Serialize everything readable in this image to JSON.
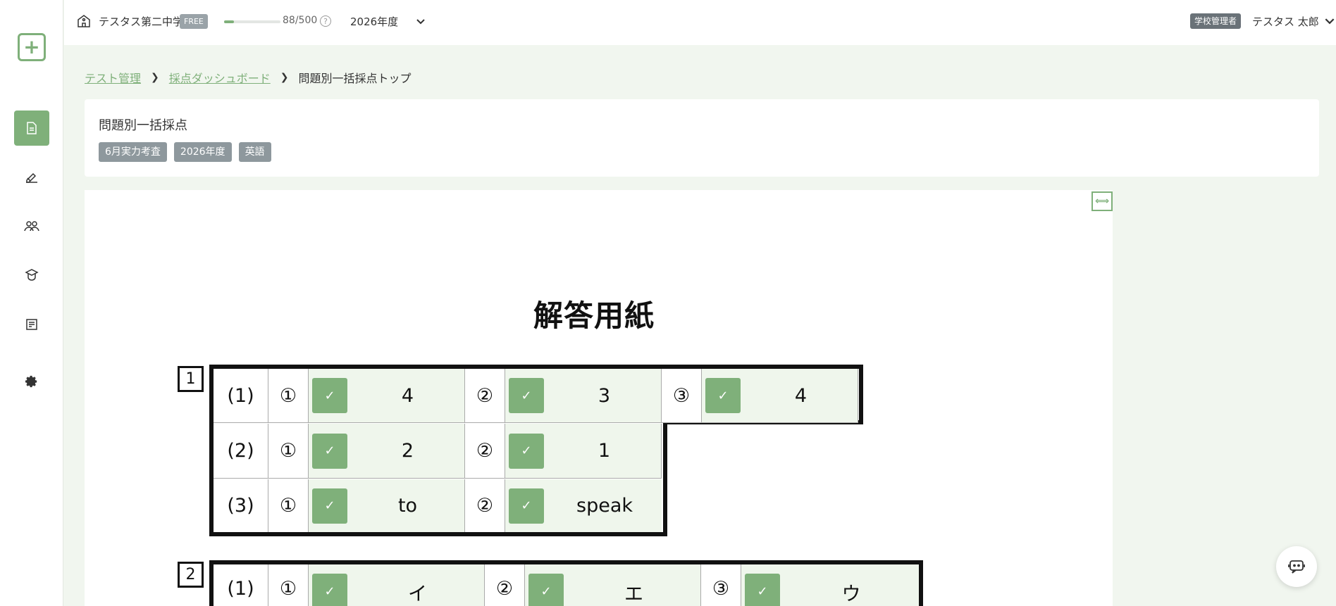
{
  "header": {
    "school_name": "テスタス第二中学",
    "plan_badge": "FREE",
    "usage": {
      "text": "88/500",
      "used": 88,
      "limit": 500
    },
    "help": "?",
    "year": "2026年度",
    "role_badge": "学校管理者",
    "user_name": "テスタス 太郎"
  },
  "sidebar": {
    "items": [
      {
        "icon": "file-icon",
        "active": true
      },
      {
        "icon": "grading-pen-icon",
        "active": false
      },
      {
        "icon": "students-group-icon",
        "active": false
      },
      {
        "icon": "teacher-icon",
        "active": false
      },
      {
        "icon": "class-book-icon",
        "active": false
      },
      {
        "icon": "gear-icon",
        "active": false
      }
    ]
  },
  "breadcrumb": {
    "items": [
      "テスト管理",
      "採点ダッシュボード",
      "問題別一括採点トップ"
    ]
  },
  "page": {
    "title": "問題別一括採点",
    "tags": [
      "6月実力考査",
      "2026年度",
      "英語"
    ]
  },
  "sheet": {
    "title": "解答用紙",
    "sections": [
      {
        "number": "1",
        "rows": [
          {
            "label": "(1)",
            "items": [
              {
                "sub": "①",
                "answer": "4",
                "checked": true
              },
              {
                "sub": "②",
                "answer": "3",
                "checked": true
              },
              {
                "sub": "③",
                "answer": "4",
                "checked": true
              }
            ]
          },
          {
            "label": "(2)",
            "items": [
              {
                "sub": "①",
                "answer": "2",
                "checked": true
              },
              {
                "sub": "②",
                "answer": "1",
                "checked": true
              }
            ]
          },
          {
            "label": "(3)",
            "items": [
              {
                "sub": "①",
                "answer": "to",
                "checked": true
              },
              {
                "sub": "②",
                "answer": "speak",
                "checked": true
              }
            ]
          }
        ]
      },
      {
        "number": "2",
        "rows": [
          {
            "label": "(1)",
            "items": [
              {
                "sub": "①",
                "answer": "イ",
                "checked": true
              },
              {
                "sub": "②",
                "answer": "エ",
                "checked": true
              },
              {
                "sub": "③",
                "answer": "ウ",
                "checked": true
              }
            ]
          }
        ]
      }
    ]
  },
  "colors": {
    "accent": "#7fb07a",
    "answer_bg": "#eff6ec"
  }
}
